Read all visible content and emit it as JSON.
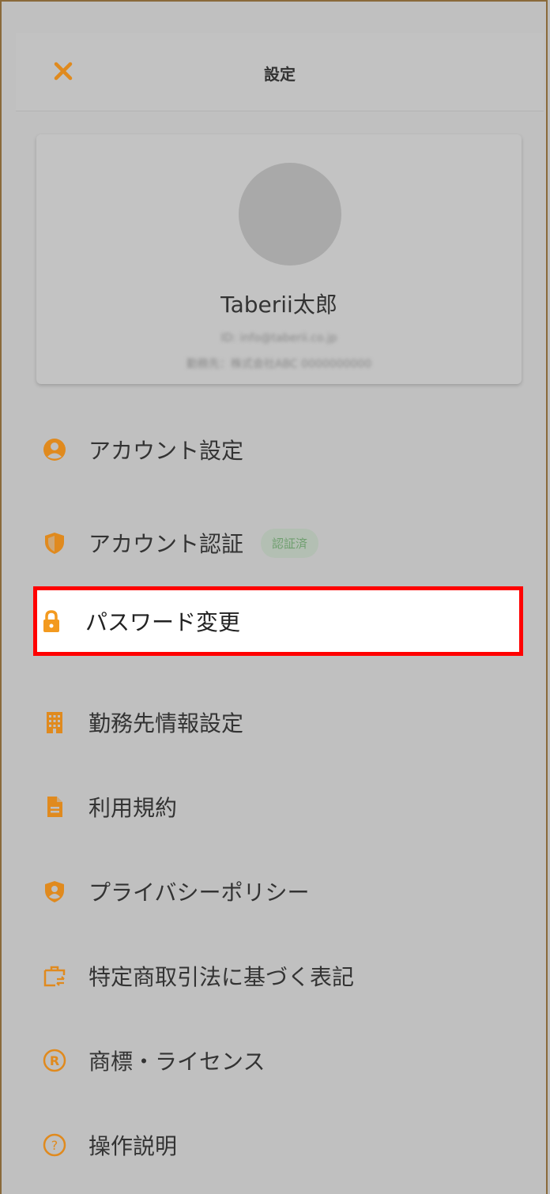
{
  "header": {
    "title": "設定"
  },
  "profile": {
    "name": "Taberii太郎",
    "email_line": "ID: info@taberii.co.jp",
    "company_line": "勤務先：株式会社ABC 0000000000"
  },
  "menu": [
    {
      "label": "アカウント設定",
      "icon": "user-circle-icon"
    },
    {
      "label": "アカウント認証",
      "icon": "shield-icon",
      "badge": "認証済"
    },
    {
      "label": "パスワード変更",
      "icon": "lock-icon",
      "selected": true
    },
    {
      "label": "勤務先情報設定",
      "icon": "building-icon"
    },
    {
      "label": "利用規約",
      "icon": "document-icon"
    },
    {
      "label": "プライバシーポリシー",
      "icon": "privacy-shield-icon"
    },
    {
      "label": "特定商取引法に基づく表記",
      "icon": "commerce-icon"
    },
    {
      "label": "商標・ライセンス",
      "icon": "registered-icon"
    },
    {
      "label": "操作説明",
      "icon": "help-circle-icon"
    }
  ],
  "colors": {
    "accent": "#e08a1e",
    "selected_border": "#ff0000",
    "badge_text": "#6f9f6f"
  }
}
